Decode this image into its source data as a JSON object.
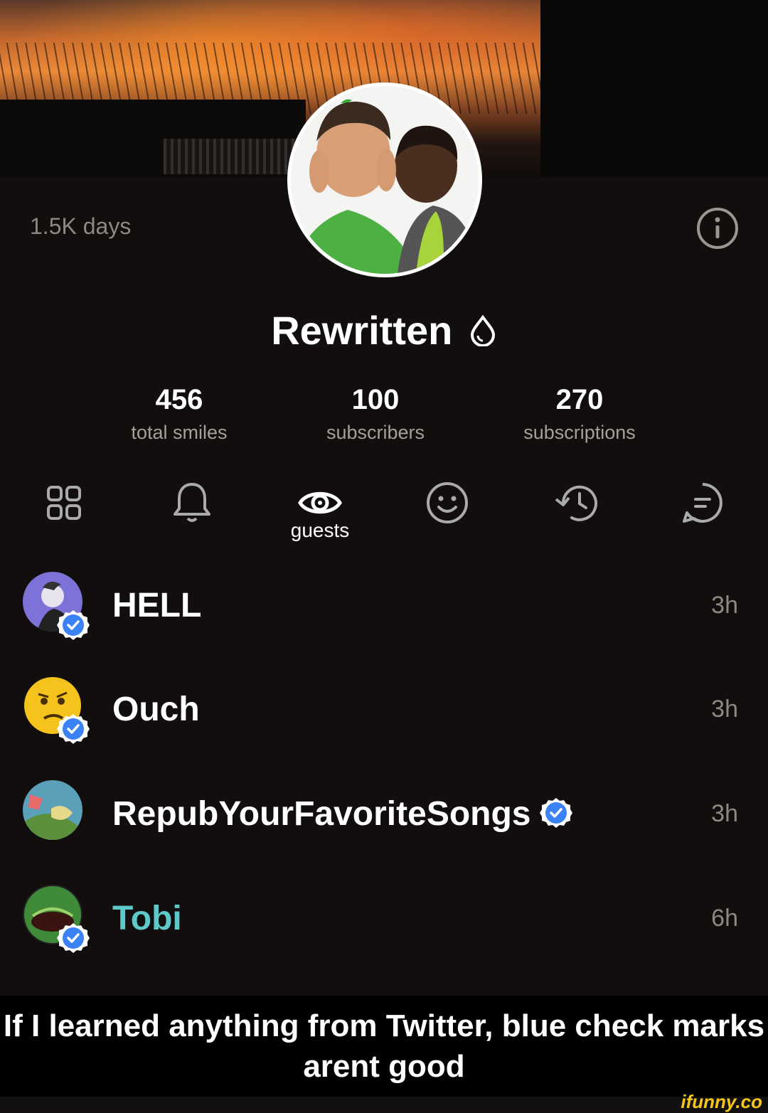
{
  "profile": {
    "days": "1.5K days",
    "username": "Rewritten",
    "stats": [
      {
        "value": "456",
        "label": "total smiles"
      },
      {
        "value": "100",
        "label": "subscribers"
      },
      {
        "value": "270",
        "label": "subscriptions"
      }
    ]
  },
  "tabs": [
    {
      "icon": "grid-icon"
    },
    {
      "icon": "bell-icon"
    },
    {
      "icon": "eye-icon",
      "label": "guests",
      "active": true
    },
    {
      "icon": "smile-icon"
    },
    {
      "icon": "history-icon"
    },
    {
      "icon": "chat-icon"
    }
  ],
  "guests": [
    {
      "name": "HELL",
      "time": "3h",
      "verified": true
    },
    {
      "name": "Ouch",
      "time": "3h",
      "verified": true
    },
    {
      "name": "RepubYourFavoriteSongs",
      "time": "3h",
      "verified": true
    },
    {
      "name": "Tobi",
      "time": "6h",
      "verified": true,
      "name_color": "#5fc8c8"
    }
  ],
  "caption": "If I learned anything from Twitter, blue check marks arent good",
  "watermark": "ifunny.co",
  "colors": {
    "badge": "#3b82f6",
    "background": "#110e0d",
    "muted": "#8c8886"
  }
}
